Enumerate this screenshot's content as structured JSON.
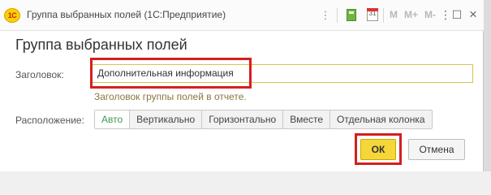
{
  "window": {
    "title": "Группа выбранных полей",
    "app": "(1С:Предприятие)",
    "logo_text": "1С",
    "toolbar": {
      "calendar_day": "31",
      "mem_m": "M",
      "mem_m_plus": "M+",
      "mem_m_minus": "M-",
      "menu_glyph": "⋮",
      "more_glyph": "⋮",
      "minimize_glyph": "☐",
      "close_glyph": "×"
    }
  },
  "form": {
    "title": "Группа выбранных полей",
    "header_label": "Заголовок:",
    "header_value": "Дополнительная информация",
    "header_hint": "Заголовок группы полей в отчете.",
    "placement_label": "Расположение:",
    "placement_options": [
      "Авто",
      "Вертикально",
      "Горизонтально",
      "Вместе",
      "Отдельная колонка"
    ],
    "placement_selected": "Авто"
  },
  "buttons": {
    "ok": "ОК",
    "cancel": "Отмена"
  },
  "colors": {
    "accent_yellow": "#f6d73a",
    "highlight_red": "#d41f1f",
    "selected_green": "#3c9a4f"
  }
}
